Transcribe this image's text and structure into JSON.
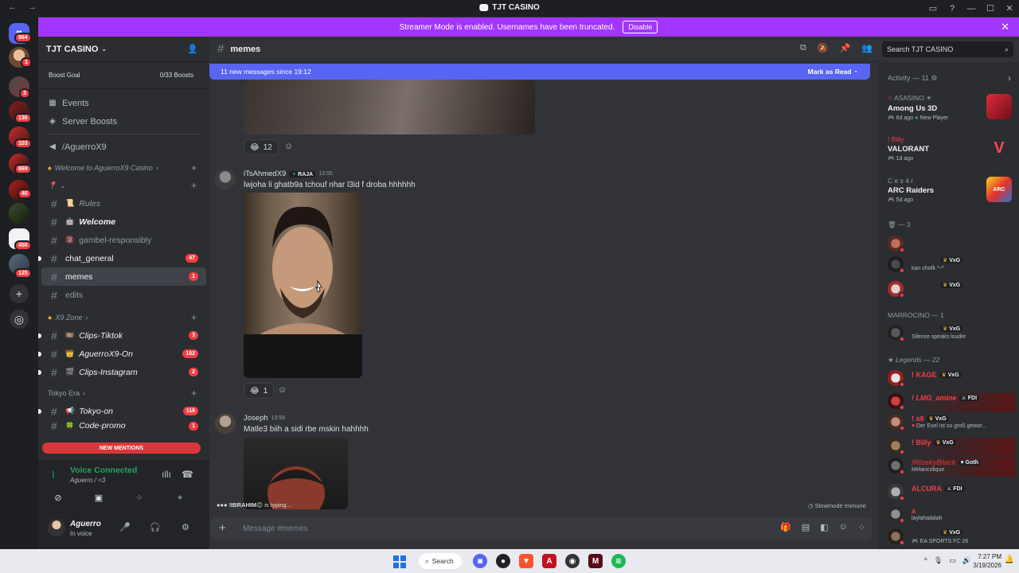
{
  "window": {
    "title": "TJT CASINO",
    "back": "←",
    "forward": "→"
  },
  "banner": {
    "text": "Streamer Mode is enabled. Usernames have been truncated.",
    "button": "Disable"
  },
  "rail": {
    "badges": [
      "984",
      "1",
      "3",
      "136",
      "103",
      "869",
      "40",
      "450",
      "125"
    ]
  },
  "server": {
    "name": "TJT CASINO",
    "boost_label": "Boost Goal",
    "boost_value": "0/33 Boosts",
    "links": [
      "Events",
      "Server Boosts",
      "/AguerroX9"
    ],
    "categories": {
      "welcome": "Welcome to AguerroX9 Casino",
      "x9zone": "X9 Zone",
      "tokyo": "Tokyo Era"
    },
    "channels": [
      {
        "name": "Rules",
        "emoji": "📜",
        "badge": ""
      },
      {
        "name": "Welcome",
        "emoji": "🤖",
        "badge": ""
      },
      {
        "name": "gambel-responsibly",
        "emoji": "🔞",
        "badge": ""
      },
      {
        "name": "chat_general",
        "emoji": "",
        "badge": "47"
      },
      {
        "name": "memes",
        "emoji": "",
        "badge": "1"
      },
      {
        "name": "edits",
        "emoji": "",
        "badge": ""
      },
      {
        "name": "Clips-Tiktok",
        "emoji": "🎞️",
        "badge": "3"
      },
      {
        "name": "AguerroX9-On",
        "emoji": "👑",
        "badge": "162"
      },
      {
        "name": "Clips-Instagram",
        "emoji": "🎬",
        "badge": "2"
      },
      {
        "name": "Tokyo-on",
        "emoji": "📢",
        "badge": "116"
      },
      {
        "name": "Code-promo",
        "emoji": "🍀",
        "badge": "1"
      }
    ],
    "new_mentions": "NEW MENTIONS"
  },
  "voice": {
    "title": "Voice Connected",
    "channel": "Aguerro / <3"
  },
  "user": {
    "name": "Aguerro",
    "status": "In voice"
  },
  "chat": {
    "channel": "memes",
    "new_messages": "11 new messages since 19:12",
    "mark_read": "Mark as Read",
    "search_placeholder": "Search TJT CASINO",
    "messages": [
      {
        "reaction_count": "12"
      },
      {
        "author": "iTsAhmedX9",
        "tag": "RAJA",
        "time": "13:55",
        "text": "lwjoha li ghatb9a tchouf nhar l3id f droba hhhhhh",
        "reaction_count": "1"
      },
      {
        "author": "Joseph",
        "time": "13:56",
        "text": "Matle3 biih a sidi rbe mskin hahhhh"
      }
    ],
    "typing_user": "!IBRAHIM😊",
    "typing_suffix": "is typing...",
    "slowmode": "Slowmode Immune",
    "composer_placeholder": "Message #memes"
  },
  "members": {
    "activity_header": "Activity — 11",
    "activities": [
      {
        "who": "ASASINO ☀",
        "game": "Among Us 3D",
        "meta": "6d ago",
        "extra": "New Player"
      },
      {
        "who": "! Billy",
        "game": "VALORANT",
        "meta": "1d ago",
        "extra": ""
      },
      {
        "who": "C e s 4 r",
        "game": "ARC Raiders",
        "meta": "5d ago",
        "extra": ""
      }
    ],
    "group1": "— 3",
    "g1_members": [
      {
        "tag": "",
        "status": ""
      },
      {
        "tag": "VxG",
        "status": "kan chofk ^-^"
      },
      {
        "tag": "VxG",
        "status": ""
      }
    ],
    "group2": "MARROCINO — 1",
    "g2_members": [
      {
        "tag": "VxG",
        "status": "Silence speaks louder"
      }
    ],
    "group3": "Legends — 22",
    "g3_members": [
      {
        "name": "! KAGE",
        "tag": "VxG",
        "status": ""
      },
      {
        "name": "! LMG_amine",
        "tag": "FDI",
        "status": ""
      },
      {
        "name": "! a8",
        "tag": "VxG",
        "status": "Der Esel ist so groß gewor..."
      },
      {
        "name": "! Billy",
        "tag": "VxG",
        "status": ""
      },
      {
        "name": "!RizekyBlack",
        "tag": "Goth",
        "status": "Mélancolique"
      },
      {
        "name": "ALCURA",
        "tag": "FDI",
        "status": ""
      },
      {
        "name": "a",
        "tag": "",
        "status": "laylahailalah"
      },
      {
        "name": "",
        "tag": "VxG",
        "status": "EA SPORTS FC 26"
      }
    ]
  },
  "taskbar": {
    "search": "Search",
    "time": "7:27 PM",
    "date": "3/19/2026"
  },
  "colors": {
    "accent": "#5865f2",
    "streamer": "#a335ff",
    "danger": "#f23f43",
    "online": "#23a55a"
  }
}
